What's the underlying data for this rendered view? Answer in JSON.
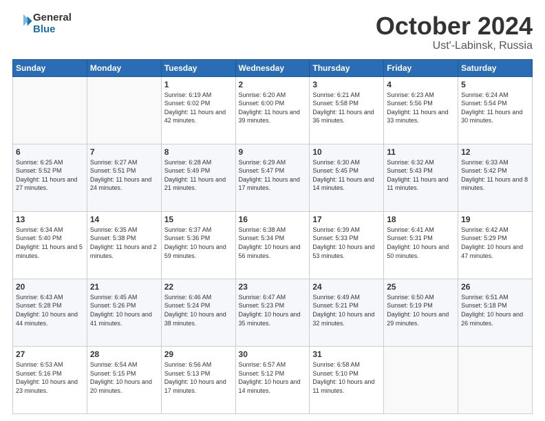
{
  "header": {
    "logo_general": "General",
    "logo_blue": "Blue",
    "title": "October 2024",
    "location": "Ust'-Labinsk, Russia"
  },
  "weekdays": [
    "Sunday",
    "Monday",
    "Tuesday",
    "Wednesday",
    "Thursday",
    "Friday",
    "Saturday"
  ],
  "weeks": [
    [
      {
        "day": "",
        "sunrise": "",
        "sunset": "",
        "daylight": ""
      },
      {
        "day": "",
        "sunrise": "",
        "sunset": "",
        "daylight": ""
      },
      {
        "day": "1",
        "sunrise": "Sunrise: 6:19 AM",
        "sunset": "Sunset: 6:02 PM",
        "daylight": "Daylight: 11 hours and 42 minutes."
      },
      {
        "day": "2",
        "sunrise": "Sunrise: 6:20 AM",
        "sunset": "Sunset: 6:00 PM",
        "daylight": "Daylight: 11 hours and 39 minutes."
      },
      {
        "day": "3",
        "sunrise": "Sunrise: 6:21 AM",
        "sunset": "Sunset: 5:58 PM",
        "daylight": "Daylight: 11 hours and 36 minutes."
      },
      {
        "day": "4",
        "sunrise": "Sunrise: 6:23 AM",
        "sunset": "Sunset: 5:56 PM",
        "daylight": "Daylight: 11 hours and 33 minutes."
      },
      {
        "day": "5",
        "sunrise": "Sunrise: 6:24 AM",
        "sunset": "Sunset: 5:54 PM",
        "daylight": "Daylight: 11 hours and 30 minutes."
      }
    ],
    [
      {
        "day": "6",
        "sunrise": "Sunrise: 6:25 AM",
        "sunset": "Sunset: 5:52 PM",
        "daylight": "Daylight: 11 hours and 27 minutes."
      },
      {
        "day": "7",
        "sunrise": "Sunrise: 6:27 AM",
        "sunset": "Sunset: 5:51 PM",
        "daylight": "Daylight: 11 hours and 24 minutes."
      },
      {
        "day": "8",
        "sunrise": "Sunrise: 6:28 AM",
        "sunset": "Sunset: 5:49 PM",
        "daylight": "Daylight: 11 hours and 21 minutes."
      },
      {
        "day": "9",
        "sunrise": "Sunrise: 6:29 AM",
        "sunset": "Sunset: 5:47 PM",
        "daylight": "Daylight: 11 hours and 17 minutes."
      },
      {
        "day": "10",
        "sunrise": "Sunrise: 6:30 AM",
        "sunset": "Sunset: 5:45 PM",
        "daylight": "Daylight: 11 hours and 14 minutes."
      },
      {
        "day": "11",
        "sunrise": "Sunrise: 6:32 AM",
        "sunset": "Sunset: 5:43 PM",
        "daylight": "Daylight: 11 hours and 11 minutes."
      },
      {
        "day": "12",
        "sunrise": "Sunrise: 6:33 AM",
        "sunset": "Sunset: 5:42 PM",
        "daylight": "Daylight: 11 hours and 8 minutes."
      }
    ],
    [
      {
        "day": "13",
        "sunrise": "Sunrise: 6:34 AM",
        "sunset": "Sunset: 5:40 PM",
        "daylight": "Daylight: 11 hours and 5 minutes."
      },
      {
        "day": "14",
        "sunrise": "Sunrise: 6:35 AM",
        "sunset": "Sunset: 5:38 PM",
        "daylight": "Daylight: 11 hours and 2 minutes."
      },
      {
        "day": "15",
        "sunrise": "Sunrise: 6:37 AM",
        "sunset": "Sunset: 5:36 PM",
        "daylight": "Daylight: 10 hours and 59 minutes."
      },
      {
        "day": "16",
        "sunrise": "Sunrise: 6:38 AM",
        "sunset": "Sunset: 5:34 PM",
        "daylight": "Daylight: 10 hours and 56 minutes."
      },
      {
        "day": "17",
        "sunrise": "Sunrise: 6:39 AM",
        "sunset": "Sunset: 5:33 PM",
        "daylight": "Daylight: 10 hours and 53 minutes."
      },
      {
        "day": "18",
        "sunrise": "Sunrise: 6:41 AM",
        "sunset": "Sunset: 5:31 PM",
        "daylight": "Daylight: 10 hours and 50 minutes."
      },
      {
        "day": "19",
        "sunrise": "Sunrise: 6:42 AM",
        "sunset": "Sunset: 5:29 PM",
        "daylight": "Daylight: 10 hours and 47 minutes."
      }
    ],
    [
      {
        "day": "20",
        "sunrise": "Sunrise: 6:43 AM",
        "sunset": "Sunset: 5:28 PM",
        "daylight": "Daylight: 10 hours and 44 minutes."
      },
      {
        "day": "21",
        "sunrise": "Sunrise: 6:45 AM",
        "sunset": "Sunset: 5:26 PM",
        "daylight": "Daylight: 10 hours and 41 minutes."
      },
      {
        "day": "22",
        "sunrise": "Sunrise: 6:46 AM",
        "sunset": "Sunset: 5:24 PM",
        "daylight": "Daylight: 10 hours and 38 minutes."
      },
      {
        "day": "23",
        "sunrise": "Sunrise: 6:47 AM",
        "sunset": "Sunset: 5:23 PM",
        "daylight": "Daylight: 10 hours and 35 minutes."
      },
      {
        "day": "24",
        "sunrise": "Sunrise: 6:49 AM",
        "sunset": "Sunset: 5:21 PM",
        "daylight": "Daylight: 10 hours and 32 minutes."
      },
      {
        "day": "25",
        "sunrise": "Sunrise: 6:50 AM",
        "sunset": "Sunset: 5:19 PM",
        "daylight": "Daylight: 10 hours and 29 minutes."
      },
      {
        "day": "26",
        "sunrise": "Sunrise: 6:51 AM",
        "sunset": "Sunset: 5:18 PM",
        "daylight": "Daylight: 10 hours and 26 minutes."
      }
    ],
    [
      {
        "day": "27",
        "sunrise": "Sunrise: 6:53 AM",
        "sunset": "Sunset: 5:16 PM",
        "daylight": "Daylight: 10 hours and 23 minutes."
      },
      {
        "day": "28",
        "sunrise": "Sunrise: 6:54 AM",
        "sunset": "Sunset: 5:15 PM",
        "daylight": "Daylight: 10 hours and 20 minutes."
      },
      {
        "day": "29",
        "sunrise": "Sunrise: 6:56 AM",
        "sunset": "Sunset: 5:13 PM",
        "daylight": "Daylight: 10 hours and 17 minutes."
      },
      {
        "day": "30",
        "sunrise": "Sunrise: 6:57 AM",
        "sunset": "Sunset: 5:12 PM",
        "daylight": "Daylight: 10 hours and 14 minutes."
      },
      {
        "day": "31",
        "sunrise": "Sunrise: 6:58 AM",
        "sunset": "Sunset: 5:10 PM",
        "daylight": "Daylight: 10 hours and 11 minutes."
      },
      {
        "day": "",
        "sunrise": "",
        "sunset": "",
        "daylight": ""
      },
      {
        "day": "",
        "sunrise": "",
        "sunset": "",
        "daylight": ""
      }
    ]
  ]
}
